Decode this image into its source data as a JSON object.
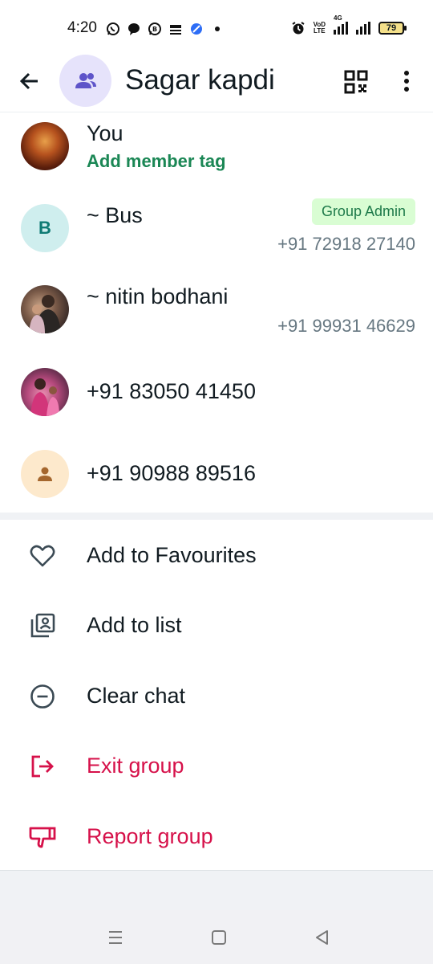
{
  "status_bar": {
    "time": "4:20",
    "left_icons": [
      "whatsapp-icon",
      "chat-bubble-icon",
      "whatsapp-business-icon",
      "news-app-icon",
      "browser-icon",
      "dot-icon"
    ],
    "network_label_top": "VoD",
    "network_label_bottom": "LTE",
    "network_type": "4G",
    "battery_level": "79"
  },
  "header": {
    "title": "Sagar kapdi",
    "avatar_color": "#e6e3fb",
    "avatar_icon_color": "#5e54c9"
  },
  "members": [
    {
      "name": "You",
      "subtitle": "Add member tag"
    },
    {
      "name": "~ Bus",
      "initial": "B",
      "badge": "Group Admin",
      "phone": "+91 72918 27140"
    },
    {
      "name": "~ nitin bodhani",
      "phone": "+91 99931 46629"
    },
    {
      "name": "+91 83050 41450"
    },
    {
      "name": "+91 90988 89516"
    }
  ],
  "actions": [
    {
      "label": "Add to Favourites",
      "icon": "heart-icon"
    },
    {
      "label": "Add to list",
      "icon": "contact-list-icon"
    },
    {
      "label": "Clear chat",
      "icon": "minus-circle-icon"
    },
    {
      "label": "Exit group",
      "icon": "exit-icon",
      "danger": true
    },
    {
      "label": "Report group",
      "icon": "thumbs-down-icon",
      "danger": true
    }
  ],
  "colors": {
    "accent_green": "#1b8755",
    "danger": "#d6114a",
    "badge_bg": "#d9fdd3"
  }
}
